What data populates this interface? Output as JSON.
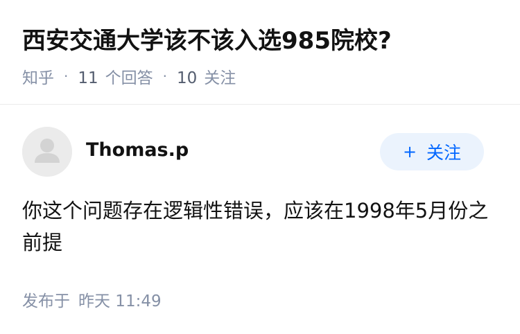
{
  "question": {
    "title": "西安交通大学该不该入选985院校?",
    "source": "知乎",
    "separator": "·",
    "answer_count": "11",
    "answer_label": "个回答",
    "follow_count": "10",
    "follow_label": "关注"
  },
  "answer": {
    "author_name": "Thomas.p",
    "avatar_icon": "default-user-avatar-icon",
    "follow_button": {
      "plus": "+",
      "label": "关注"
    },
    "content": "你这个问题存在逻辑性错误，应该在1998年5月份之前提",
    "published_label": "发布于",
    "published_time": "昨天 11:49"
  },
  "colors": {
    "text_primary": "#121212",
    "text_secondary": "#8590a6",
    "brand_blue": "#0066ff",
    "follow_bg": "#ebf3fd",
    "avatar_bg": "#ebebeb",
    "divider": "#ebebeb"
  }
}
